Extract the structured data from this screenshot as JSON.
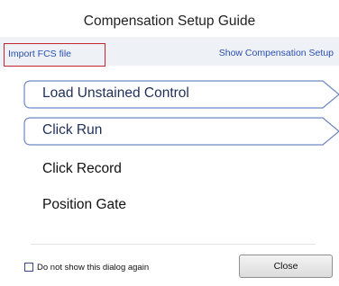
{
  "dialog": {
    "title": "Compensation Setup Guide"
  },
  "links": {
    "import_label": "Import FCS file",
    "show_label": "Show Compensation Setup"
  },
  "steps": [
    {
      "label": "Load Unstained Control",
      "style": "arrow"
    },
    {
      "label": "Click Run",
      "style": "arrow"
    },
    {
      "label": "Click Record",
      "style": "plain"
    },
    {
      "label": "Position Gate",
      "style": "plain"
    }
  ],
  "footer": {
    "checkbox_label": "Do not show this dialog again",
    "checkbox_checked": false,
    "close_label": "Close"
  },
  "colors": {
    "accent_link": "#2a4fb0",
    "highlight_border": "#c1272d",
    "step_border": "#6f86c4",
    "step_text": "#1f2f5a"
  }
}
